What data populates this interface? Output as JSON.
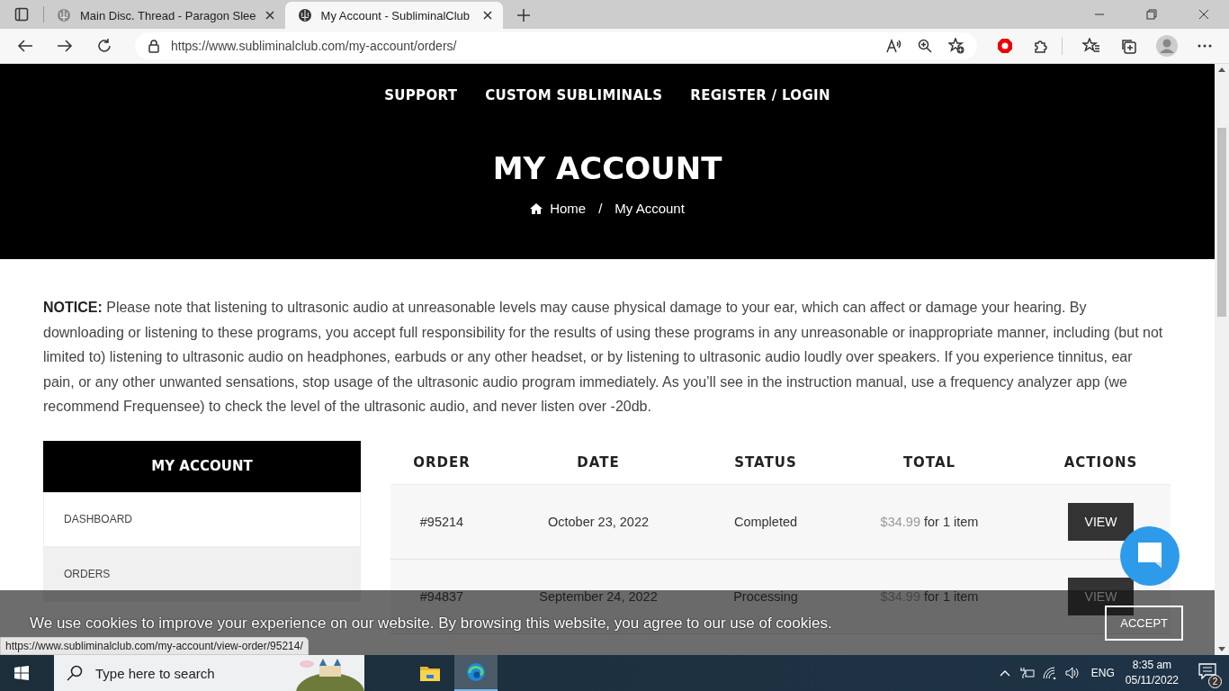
{
  "browser": {
    "tabs": [
      {
        "title": "Main Disc. Thread - Paragon Slee",
        "selected": false
      },
      {
        "title": "My Account - SubliminalClub",
        "selected": true
      }
    ],
    "url": "https://www.subliminalclub.com/my-account/orders/"
  },
  "nav": [
    "SUPPORT",
    "CUSTOM SUBLIMINALS",
    "REGISTER / LOGIN"
  ],
  "hero": {
    "title": "MY ACCOUNT",
    "breadcrumb": [
      {
        "label": "Home",
        "kind": "home"
      },
      {
        "label": "My Account",
        "kind": "current"
      }
    ],
    "separator": "/"
  },
  "notice": "**NOTICE:** Please note that listening to ultrasonic audio at unreasonable levels may cause physical damage to your ear, which can affect or damage your hearing. By downloading or listening to these programs, you accept full responsibility for the results of using these programs in any unreasonable or inappropriate manner, including (but not limited to) listening to ultrasonic audio on headphones, earbuds or any other headset, or by listening to ultrasonic audio loudly over speakers.  If you experience tinnitus, ear pain, or any other unwanted sensations, stop usage of the ultrasonic audio program immediately. As you’ll see in the instruction manual, use a frequency analyzer app (we recommend Frequensee) to check the level of the ultrasonic audio, and never listen over -20db.",
  "sidebar": {
    "title": "MY ACCOUNT",
    "items": [
      {
        "label": "DASHBOARD",
        "selected": false
      },
      {
        "label": "ORDERS",
        "selected": true
      }
    ]
  },
  "table": {
    "columns": [
      "ORDER",
      "DATE",
      "STATUS",
      "TOTAL",
      "ACTIONS"
    ],
    "rows": [
      {
        "order": "#95214",
        "date": "October 23, 2022",
        "status": "Completed",
        "price": "$34.99",
        "quantity": "for 1 item",
        "action": "VIEW"
      },
      {
        "order": "#94837",
        "date": "September 24, 2022",
        "status": "Processing",
        "price": "$34.99",
        "quantity": "for 1 item",
        "action": "VIEW"
      }
    ]
  },
  "cookie_bar": {
    "text": "We use cookies to improve your experience on our website. By browsing this website, you agree to our use of cookies.",
    "button": "ACCEPT"
  },
  "status_tooltip": "https://www.subliminalclub.com/my-account/view-order/95214/",
  "taskbar": {
    "search_placeholder": "Type here to search",
    "language": "ENG",
    "time": "8:35 am",
    "date": "05/11/2022",
    "notifications": "2"
  }
}
